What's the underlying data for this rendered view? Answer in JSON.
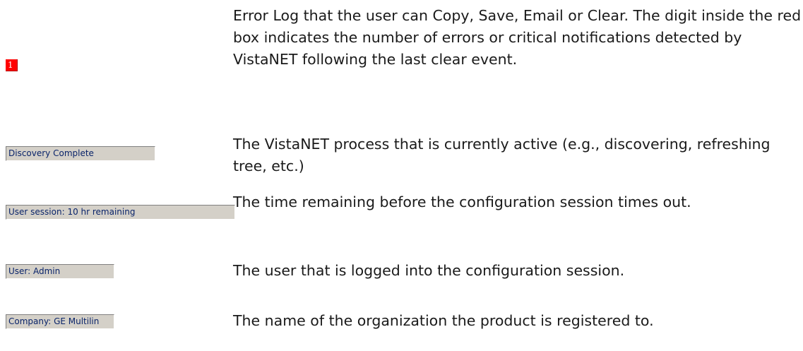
{
  "items": [
    {
      "indicator": "1",
      "description": "Error Log that the user can Copy, Save, Email or Clear. The digit inside the red box indicates the number of errors or critical notifications detected by VistaNET following the last clear event."
    },
    {
      "indicator": "Discovery Complete",
      "description": "The VistaNET process that is currently active (e.g., discovering, refreshing tree, etc.)"
    },
    {
      "indicator": "User session: 10 hr remaining",
      "description": "The time remaining before the configuration session times out."
    },
    {
      "indicator": "User: Admin",
      "description": "The user that is logged into the configuration session."
    },
    {
      "indicator": "Company: GE Multilin",
      "description": "The name of the organization the product is registered to."
    }
  ],
  "colors": {
    "error_box": "#ff0000",
    "status_field": "#d4d0c8",
    "status_text": "#0a246a"
  }
}
